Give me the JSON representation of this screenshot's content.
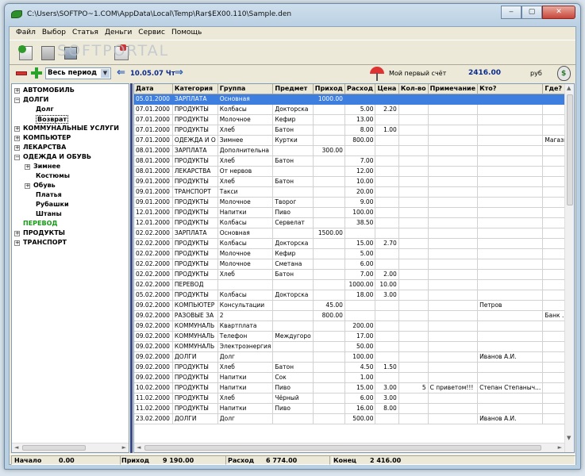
{
  "window": {
    "title": "C:\\Users\\SOFTPO~1.COM\\AppData\\Local\\Temp\\Rar$EX00.110\\Sample.den",
    "minimize": "‒",
    "maximize": "▢",
    "close": "✕"
  },
  "menu": [
    "Файл",
    "Выбор",
    "Статья",
    "Деньги",
    "Сервис",
    "Помощь"
  ],
  "watermark": "SOFTPORTAL",
  "period": {
    "select_value": "Весь период",
    "date": "10.05.07 Чт"
  },
  "account": {
    "name": "Мой первый счёт",
    "balance": "2416.00",
    "currency": "руб"
  },
  "tree": [
    {
      "label": "АВТОМОБИЛЬ",
      "exp": "+",
      "level": 0
    },
    {
      "label": "ДОЛГИ",
      "exp": "−",
      "level": 0
    },
    {
      "label": "Долг",
      "exp": "",
      "level": 1
    },
    {
      "label": "Возврат",
      "exp": "",
      "level": 1,
      "selected": true
    },
    {
      "label": "КОММУНАЛЬНЫЕ УСЛУГИ",
      "exp": "+",
      "level": 0
    },
    {
      "label": "КОМПЬЮТЕР",
      "exp": "+",
      "level": 0
    },
    {
      "label": "ЛЕКАРСТВА",
      "exp": "+",
      "level": 0
    },
    {
      "label": "ОДЕЖДА И ОБУВЬ",
      "exp": "−",
      "level": 0
    },
    {
      "label": "Зимнее",
      "exp": "+",
      "level": 1
    },
    {
      "label": "Костюмы",
      "exp": "",
      "level": 1
    },
    {
      "label": "Обувь",
      "exp": "+",
      "level": 1
    },
    {
      "label": "Платья",
      "exp": "",
      "level": 1
    },
    {
      "label": "Рубашки",
      "exp": "",
      "level": 1
    },
    {
      "label": "Штаны",
      "exp": "",
      "level": 1
    },
    {
      "label": "ПЕРЕВОД",
      "exp": "",
      "level": 0,
      "green": true
    },
    {
      "label": "ПРОДУКТЫ",
      "exp": "+",
      "level": 0
    },
    {
      "label": "ТРАНСПОРТ",
      "exp": "+",
      "level": 0
    }
  ],
  "table": {
    "columns": [
      "Дата",
      "Категория",
      "Группа",
      "Предмет",
      "Приход",
      "Расход",
      "Цена",
      "Кол-во",
      "Примечание",
      "Кто?",
      "Где?"
    ],
    "rows": [
      [
        "05.01.2000",
        "ЗАРПЛАТА",
        "Основная",
        "",
        "1000.00",
        "",
        "",
        "",
        "",
        "",
        ""
      ],
      [
        "07.01.2000",
        "ПРОДУКТЫ",
        "Колбасы",
        "Докторска",
        "",
        "5.00",
        "2.20",
        "",
        "",
        "",
        ""
      ],
      [
        "07.01.2000",
        "ПРОДУКТЫ",
        "Молочное",
        "Кефир",
        "",
        "13.00",
        "",
        "",
        "",
        "",
        ""
      ],
      [
        "07.01.2000",
        "ПРОДУКТЫ",
        "Хлеб",
        "Батон",
        "",
        "8.00",
        "1.00",
        "",
        "",
        "",
        ""
      ],
      [
        "07.01.2000",
        "ОДЕЖДА И О",
        "Зимнее",
        "Куртки",
        "",
        "800.00",
        "",
        "",
        "",
        "",
        "Магазин"
      ],
      [
        "08.01.2000",
        "ЗАРПЛАТА",
        "Дополнительна",
        "",
        "300.00",
        "",
        "",
        "",
        "",
        "",
        ""
      ],
      [
        "08.01.2000",
        "ПРОДУКТЫ",
        "Хлеб",
        "Батон",
        "",
        "7.00",
        "",
        "",
        "",
        "",
        ""
      ],
      [
        "08.01.2000",
        "ЛЕКАРСТВА",
        "От нервов",
        "",
        "",
        "12.00",
        "",
        "",
        "",
        "",
        ""
      ],
      [
        "09.01.2000",
        "ПРОДУКТЫ",
        "Хлеб",
        "Батон",
        "",
        "10.00",
        "",
        "",
        "",
        "",
        ""
      ],
      [
        "09.01.2000",
        "ТРАНСПОРТ",
        "Такси",
        "",
        "",
        "20.00",
        "",
        "",
        "",
        "",
        ""
      ],
      [
        "09.01.2000",
        "ПРОДУКТЫ",
        "Молочное",
        "Творог",
        "",
        "9.00",
        "",
        "",
        "",
        "",
        ""
      ],
      [
        "12.01.2000",
        "ПРОДУКТЫ",
        "Напитки",
        "Пиво",
        "",
        "100.00",
        "",
        "",
        "",
        "",
        ""
      ],
      [
        "12.01.2000",
        "ПРОДУКТЫ",
        "Колбасы",
        "Сервелат",
        "",
        "38.50",
        "",
        "",
        "",
        "",
        ""
      ],
      [
        "02.02.2000",
        "ЗАРПЛАТА",
        "Основная",
        "",
        "1500.00",
        "",
        "",
        "",
        "",
        "",
        ""
      ],
      [
        "02.02.2000",
        "ПРОДУКТЫ",
        "Колбасы",
        "Докторска",
        "",
        "15.00",
        "2.70",
        "",
        "",
        "",
        ""
      ],
      [
        "02.02.2000",
        "ПРОДУКТЫ",
        "Молочное",
        "Кефир",
        "",
        "5.00",
        "",
        "",
        "",
        "",
        ""
      ],
      [
        "02.02.2000",
        "ПРОДУКТЫ",
        "Молочное",
        "Сметана",
        "",
        "6.00",
        "",
        "",
        "",
        "",
        ""
      ],
      [
        "02.02.2000",
        "ПРОДУКТЫ",
        "Хлеб",
        "Батон",
        "",
        "7.00",
        "2.00",
        "",
        "",
        "",
        ""
      ],
      [
        "02.02.2000",
        "ПЕРЕВОД",
        "",
        "",
        "",
        "1000.00",
        "10.00",
        "",
        "",
        "",
        ""
      ],
      [
        "05.02.2000",
        "ПРОДУКТЫ",
        "Колбасы",
        "Докторска",
        "",
        "18.00",
        "3.00",
        "",
        "",
        "",
        ""
      ],
      [
        "09.02.2000",
        "КОМПЬЮТЕР",
        "Консультации",
        "",
        "45.00",
        "",
        "",
        "",
        "",
        "Петров",
        ""
      ],
      [
        "09.02.2000",
        "РАЗОВЫЕ ЗА",
        "2",
        "",
        "800.00",
        "",
        "",
        "",
        "",
        "",
        "Банк ..."
      ],
      [
        "09.02.2000",
        "КОММУНАЛЬ",
        "Квартплата",
        "",
        "",
        "200.00",
        "",
        "",
        "",
        "",
        ""
      ],
      [
        "09.02.2000",
        "КОММУНАЛЬ",
        "Телефон",
        "Междугоро",
        "",
        "17.00",
        "",
        "",
        "",
        "",
        ""
      ],
      [
        "09.02.2000",
        "КОММУНАЛЬ",
        "Электроэнергия",
        "",
        "",
        "50.00",
        "",
        "",
        "",
        "",
        ""
      ],
      [
        "09.02.2000",
        "ДОЛГИ",
        "Долг",
        "",
        "",
        "100.00",
        "",
        "",
        "",
        "Иванов А.И.",
        ""
      ],
      [
        "09.02.2000",
        "ПРОДУКТЫ",
        "Хлеб",
        "Батон",
        "",
        "4.50",
        "1.50",
        "",
        "",
        "",
        ""
      ],
      [
        "09.02.2000",
        "ПРОДУКТЫ",
        "Напитки",
        "Сок",
        "",
        "1.00",
        "",
        "",
        "",
        "",
        ""
      ],
      [
        "10.02.2000",
        "ПРОДУКТЫ",
        "Напитки",
        "Пиво",
        "",
        "15.00",
        "3.00",
        "5",
        "С приветом!!!",
        "Степан Степаныч...",
        ""
      ],
      [
        "11.02.2000",
        "ПРОДУКТЫ",
        "Хлеб",
        "Чёрный",
        "",
        "6.00",
        "3.00",
        "",
        "",
        "",
        ""
      ],
      [
        "11.02.2000",
        "ПРОДУКТЫ",
        "Напитки",
        "Пиво",
        "",
        "16.00",
        "8.00",
        "",
        "",
        "",
        ""
      ],
      [
        "23.02.2000",
        "ДОЛГИ",
        "Долг",
        "",
        "",
        "500.00",
        "",
        "",
        "",
        "Иванов А.И.",
        ""
      ]
    ]
  },
  "status": {
    "start_label": "Начало",
    "start_value": "0.00",
    "income_label": "Приход",
    "income_value": "9 190.00",
    "expense_label": "Расход",
    "expense_value": "6 774.00",
    "end_label": "Конец",
    "end_value": "2 416.00"
  }
}
